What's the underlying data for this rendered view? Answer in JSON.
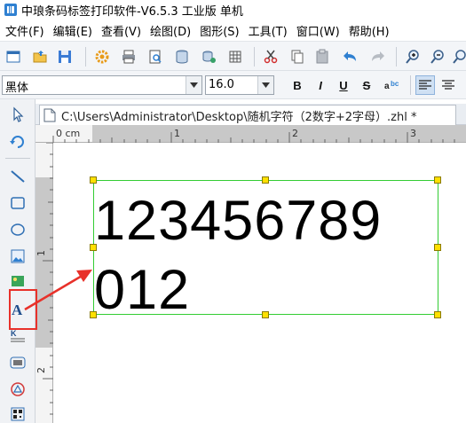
{
  "window": {
    "title": "中琅条码标签打印软件-V6.5.3 工业版 单机"
  },
  "menu": [
    {
      "label": "文件(F)"
    },
    {
      "label": "编辑(E)"
    },
    {
      "label": "查看(V)"
    },
    {
      "label": "绘图(D)"
    },
    {
      "label": "图形(S)"
    },
    {
      "label": "工具(T)"
    },
    {
      "label": "窗口(W)"
    },
    {
      "label": "帮助(H)"
    }
  ],
  "format_bar": {
    "font_name": "黑体",
    "font_size": "16.0",
    "bold_label": "B",
    "italic_label": "I",
    "underline_label": "U",
    "strike_label": "S"
  },
  "document": {
    "tab_path": "C:\\Users\\Administrator\\Desktop\\随机字符（2数字+2字母）.zhl *"
  },
  "ruler": {
    "unit_label": "0 cm",
    "top_marks": [
      "1",
      "2",
      "3"
    ],
    "left_marks": [
      "1",
      "2"
    ]
  },
  "label_text": {
    "line1": "123456789",
    "line2": "012"
  },
  "colors": {
    "selection_border": "#33cc33",
    "handle": "#ffe000",
    "annotation": "#e8312a"
  },
  "icons": {
    "toolbar": [
      "new-icon",
      "open-icon",
      "save-icon",
      "settings-icon",
      "print-icon",
      "print-preview-icon",
      "database-icon",
      "db-settings-icon",
      "grid-icon",
      "cut-icon",
      "copy-icon",
      "paste-icon",
      "undo-icon",
      "redo-icon",
      "zoom-in-icon",
      "zoom-out-icon",
      "zoom-fit-icon"
    ],
    "left_tools": [
      "select-arrow-icon",
      "rotate-icon",
      "line-icon",
      "rectangle-icon",
      "ellipse-icon",
      "image-icon",
      "picture-icon",
      "text-icon",
      "rich-text-icon",
      "barcode-icon",
      "shape-icon",
      "qrcode-icon"
    ]
  }
}
